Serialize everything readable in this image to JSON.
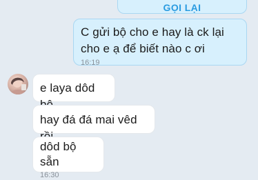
{
  "callback": {
    "label": "GỌI LẠI"
  },
  "messages": [
    {
      "direction": "out",
      "text": "C gửi bộ cho e hay là ck lại cho e ạ để biết nào c ơi",
      "time": "16:19"
    },
    {
      "direction": "in",
      "text": "e laya dôd bộ"
    },
    {
      "direction": "in",
      "text": "hay đá đá mai vêd rồi"
    },
    {
      "direction": "in",
      "text": "dôd bộ sẵn",
      "time": "16:30"
    }
  ],
  "colors": {
    "background": "#e4ebf2",
    "outgoing_bubble": "#d7f0fd",
    "incoming_bubble": "#ffffff",
    "accent": "#2a9be0"
  }
}
